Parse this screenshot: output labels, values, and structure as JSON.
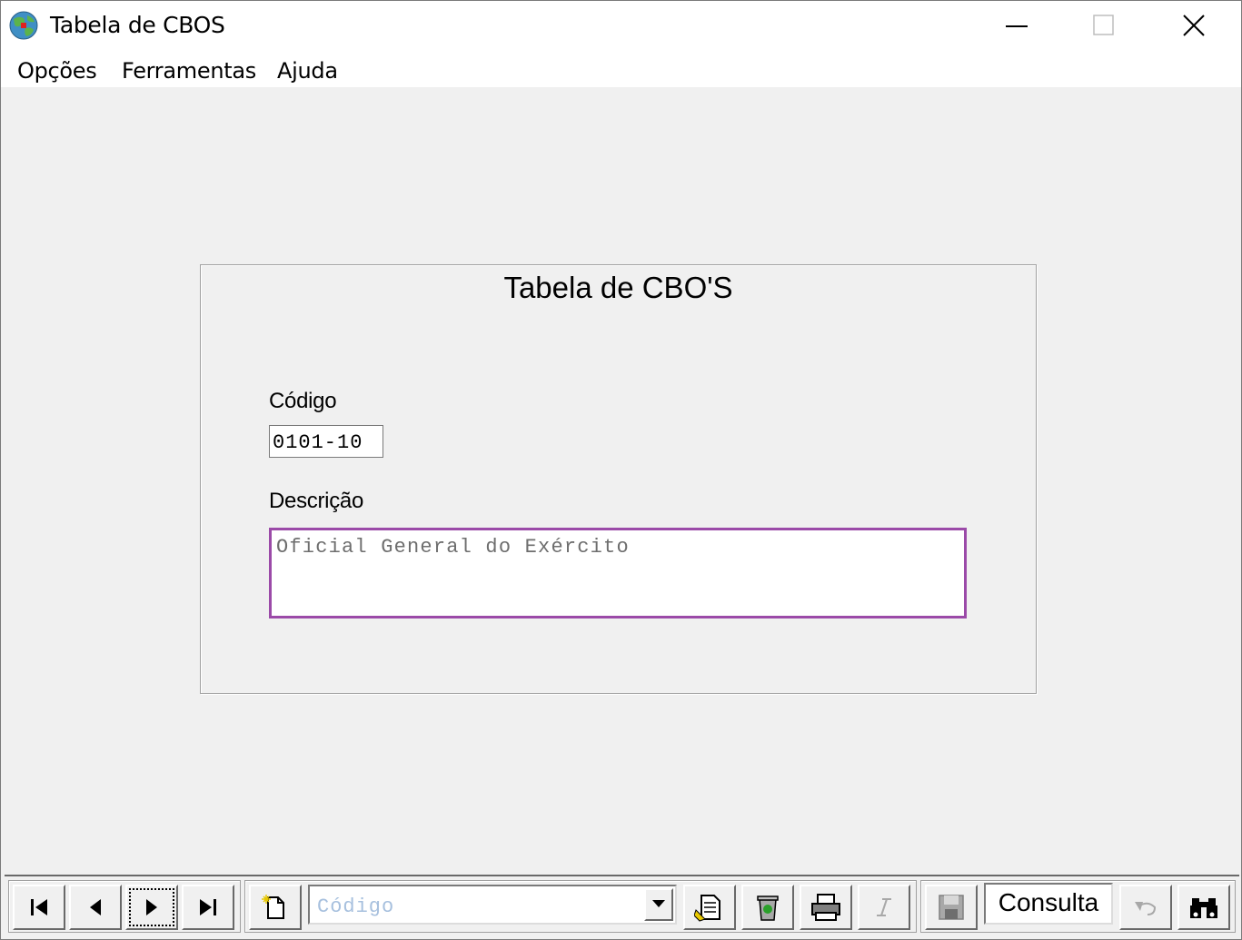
{
  "window": {
    "title": "Tabela de CBOS",
    "controls": {
      "minimize": "minimize-icon",
      "maximize": "maximize-icon",
      "close": "close-icon"
    }
  },
  "menu": [
    {
      "label": "Opções"
    },
    {
      "label": "Ferramentas"
    },
    {
      "label": "Ajuda"
    }
  ],
  "form": {
    "title": "Tabela de CBO'S",
    "codigo_label": "Código",
    "codigo_value": "0101-10",
    "descricao_label": "Descrição",
    "descricao_value": "Oficial General do Exército",
    "focus_border_color": "#9b4aa8"
  },
  "toolbar": {
    "nav": [
      "first-record-icon",
      "previous-record-icon",
      "next-record-icon",
      "last-record-icon"
    ],
    "search_combo_value": "Código",
    "actions": [
      "new-record-icon",
      "edit-record-icon",
      "delete-record-icon",
      "print-icon",
      "italic-icon",
      "save-icon",
      "undo-icon",
      "binoculars-icon"
    ],
    "mode_status": "Consulta"
  },
  "colors": {
    "window_bg": "#f0f0f0",
    "combo_text": "#a7c0de"
  }
}
